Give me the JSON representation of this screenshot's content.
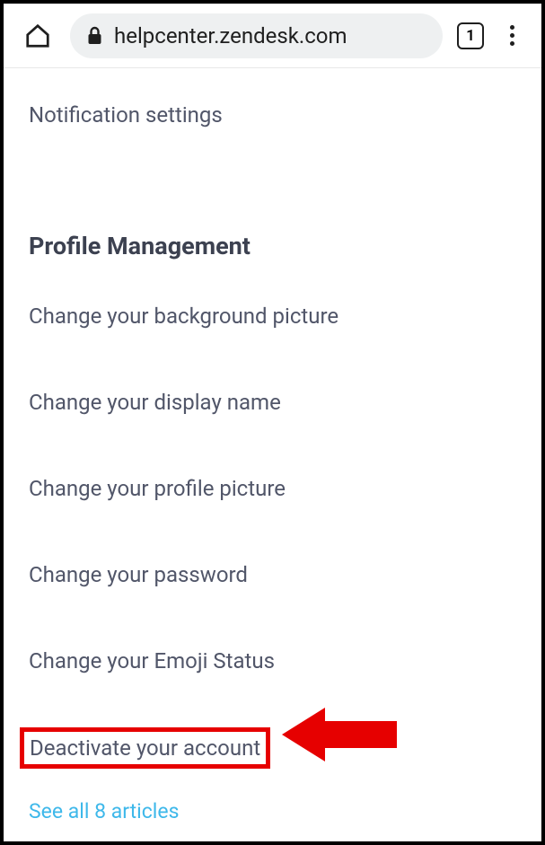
{
  "browser": {
    "url": "helpcenter.zendesk.com",
    "tab_count": "1"
  },
  "top_link": "Notification settings",
  "section_title": "Profile Management",
  "articles": [
    "Change your background picture",
    "Change your display name",
    "Change your profile picture",
    "Change your password",
    "Change your Emoji Status",
    "Deactivate your account"
  ],
  "see_all": "See all 8 articles"
}
